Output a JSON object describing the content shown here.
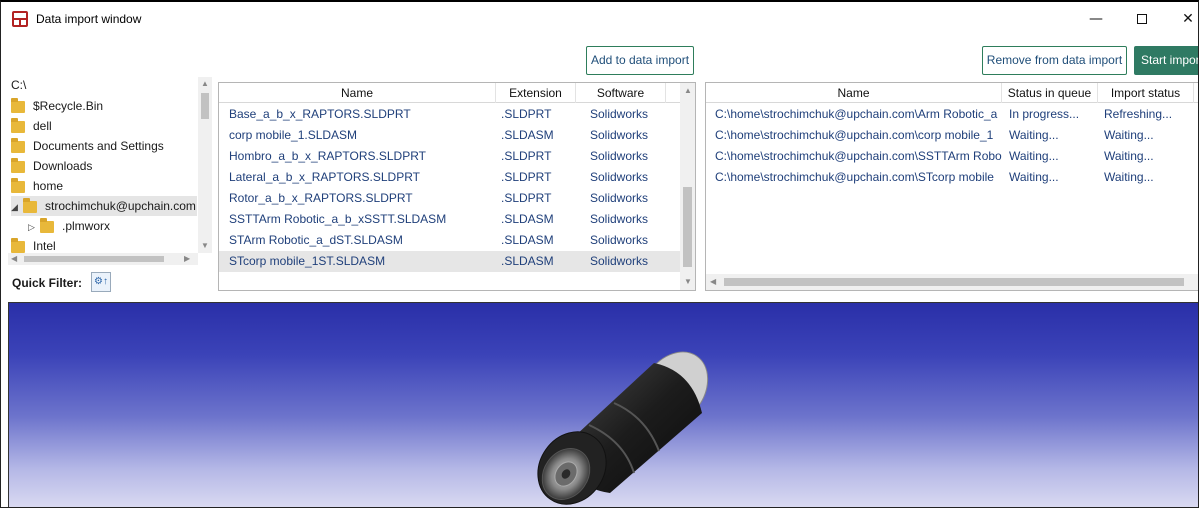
{
  "window": {
    "title": "Data import window",
    "minimize_glyph": "—",
    "close_glyph": "✕"
  },
  "toolbar": {
    "add_label": "Add to data import",
    "remove_label": "Remove from data import",
    "start_label": "Start import"
  },
  "tree": {
    "root": "C:\\",
    "items": [
      {
        "label": "$Recycle.Bin"
      },
      {
        "label": "dell"
      },
      {
        "label": "Documents and Settings"
      },
      {
        "label": "Downloads"
      },
      {
        "label": "home"
      },
      {
        "label": "strochimchuk@upchain.com"
      },
      {
        "label": ".plmworx"
      },
      {
        "label": "Intel"
      }
    ],
    "quick_filter_label": "Quick Filter:"
  },
  "file_list": {
    "headers": [
      "Name",
      "Extension",
      "Software"
    ],
    "rows": [
      {
        "name": "Base_a_b_x_RAPTORS.SLDPRT",
        "ext": ".SLDPRT",
        "software": "Solidworks"
      },
      {
        "name": "corp mobile_1.SLDASM",
        "ext": ".SLDASM",
        "software": "Solidworks"
      },
      {
        "name": "Hombro_a_b_x_RAPTORS.SLDPRT",
        "ext": ".SLDPRT",
        "software": "Solidworks"
      },
      {
        "name": "Lateral_a_b_x_RAPTORS.SLDPRT",
        "ext": ".SLDPRT",
        "software": "Solidworks"
      },
      {
        "name": "Rotor_a_b_x_RAPTORS.SLDPRT",
        "ext": ".SLDPRT",
        "software": "Solidworks"
      },
      {
        "name": "SSTTArm Robotic_a_b_xSSTT.SLDASM",
        "ext": ".SLDASM",
        "software": "Solidworks"
      },
      {
        "name": "STArm Robotic_a_dST.SLDASM",
        "ext": ".SLDASM",
        "software": "Solidworks"
      },
      {
        "name": "STcorp mobile_1ST.SLDASM",
        "ext": ".SLDASM",
        "software": "Solidworks"
      }
    ]
  },
  "queue": {
    "headers": [
      "Name",
      "Status in queue",
      "Import status"
    ],
    "rows": [
      {
        "name": "C:\\home\\strochimchuk@upchain.com\\Arm Robotic_a",
        "status": "In progress...",
        "import": "Refreshing..."
      },
      {
        "name": "C:\\home\\strochimchuk@upchain.com\\corp mobile_1",
        "status": "Waiting...",
        "import": "Waiting..."
      },
      {
        "name": "C:\\home\\strochimchuk@upchain.com\\SSTTArm Robo",
        "status": "Waiting...",
        "import": "Waiting..."
      },
      {
        "name": "C:\\home\\strochimchuk@upchain.com\\STcorp mobile",
        "status": "Waiting...",
        "import": "Waiting..."
      }
    ]
  },
  "colors": {
    "accent": "#2f7a63",
    "link_text": "#1f3f7a",
    "viewer_top": "#2a2fa8",
    "viewer_bottom": "#dcdcf2"
  }
}
